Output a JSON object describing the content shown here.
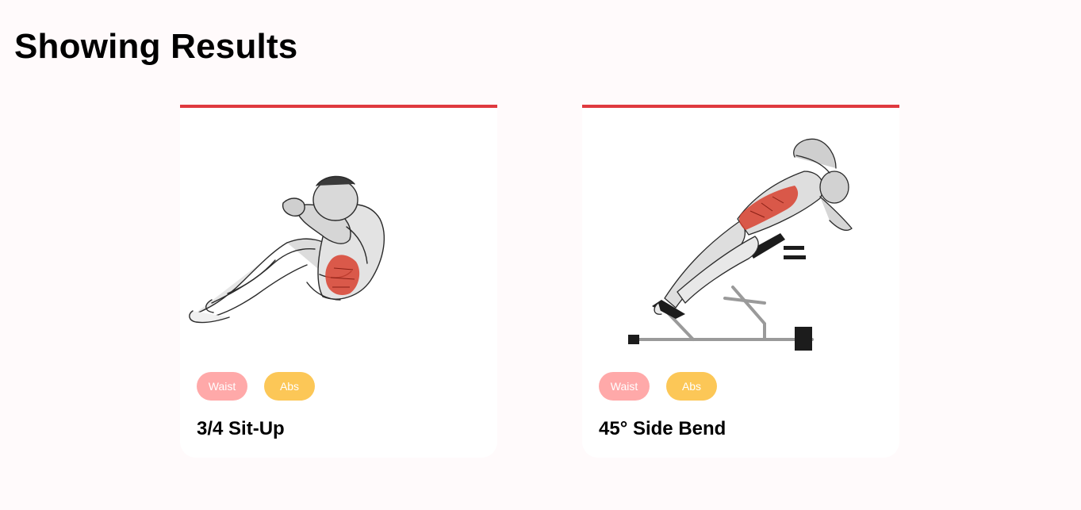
{
  "page": {
    "heading": "Showing Results"
  },
  "theme": {
    "accent": "#e0393e",
    "tag_waist": "#ffa9a9",
    "tag_abs": "#fcc757",
    "muscle_highlight": "#d8412f"
  },
  "results": [
    {
      "name": "3/4 Sit-Up",
      "tags": [
        "Waist",
        "Abs"
      ],
      "illustration": "sit-up-figure"
    },
    {
      "name": "45° Side Bend",
      "tags": [
        "Waist",
        "Abs"
      ],
      "illustration": "side-bend-bench-figure"
    }
  ]
}
